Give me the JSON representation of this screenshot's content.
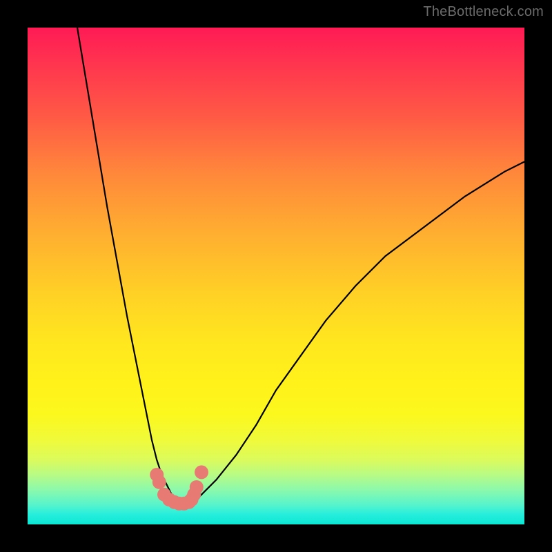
{
  "watermark": "TheBottleneck.com",
  "chart_data": {
    "type": "line",
    "title": "",
    "xlabel": "",
    "ylabel": "",
    "xlim": [
      0,
      100
    ],
    "ylim": [
      0,
      100
    ],
    "grid": false,
    "legend": false,
    "series": [
      {
        "name": "left-curve",
        "color": "#000000",
        "x": [
          10,
          12,
          14,
          16,
          18,
          20,
          22,
          24,
          25,
          26,
          27,
          28,
          29,
          30,
          31,
          32
        ],
        "y": [
          100,
          88,
          76,
          64,
          53,
          42,
          32,
          22,
          17,
          13,
          10,
          8,
          6,
          5,
          4,
          4
        ]
      },
      {
        "name": "right-curve",
        "color": "#000000",
        "x": [
          33,
          35,
          38,
          42,
          46,
          50,
          55,
          60,
          66,
          72,
          80,
          88,
          96,
          100
        ],
        "y": [
          4,
          6,
          9,
          14,
          20,
          27,
          34,
          41,
          48,
          54,
          60,
          66,
          71,
          73
        ]
      },
      {
        "name": "valley-markers",
        "color": "#e77b73",
        "type": "scatter",
        "x": [
          26.0,
          26.5,
          27.5,
          28.5,
          29.5,
          30.5,
          31.5,
          32.5,
          33.0,
          33.5,
          34.0,
          35.0
        ],
        "y": [
          10.0,
          8.5,
          6.0,
          5.0,
          4.5,
          4.2,
          4.2,
          4.5,
          5.0,
          6.0,
          7.5,
          10.5
        ]
      }
    ],
    "background_gradient": {
      "top": "#ff1a55",
      "mid": "#ffe81e",
      "bottom": "#0ce6d4"
    }
  }
}
